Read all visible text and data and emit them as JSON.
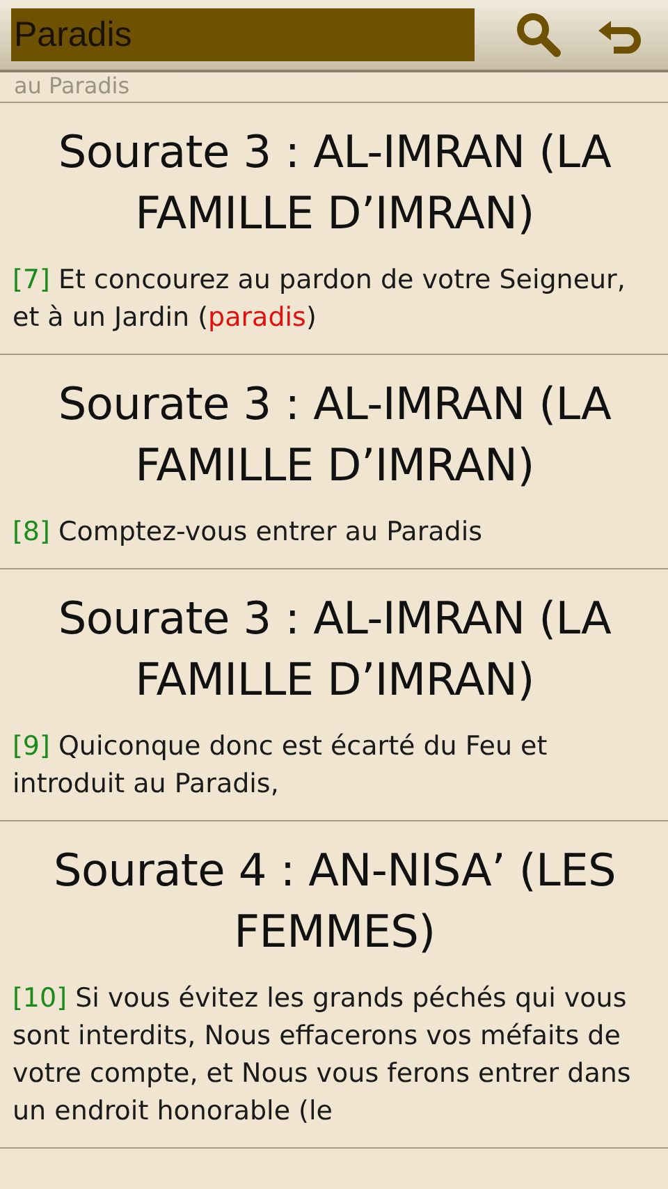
{
  "search": {
    "value": "Paradis"
  },
  "clipped_text": "au Paradis",
  "results": [
    {
      "title": "Sourate 3 : AL-IMRAN (LA FAMILLE D’IMRAN)",
      "verse_number": "[7]",
      "segments": [
        {
          "text": "Et concourez au pardon de votre Seigneur, et à un Jardin (",
          "highlight": false
        },
        {
          "text": "paradis",
          "highlight": true
        },
        {
          "text": ")",
          "highlight": false
        }
      ]
    },
    {
      "title": "Sourate 3 : AL-IMRAN (LA FAMILLE D’IMRAN)",
      "verse_number": "[8]",
      "segments": [
        {
          "text": "Comptez-vous entrer au Paradis",
          "highlight": false
        }
      ]
    },
    {
      "title": "Sourate 3 : AL-IMRAN (LA FAMILLE D’IMRAN)",
      "verse_number": "[9]",
      "segments": [
        {
          "text": "Quiconque donc est écarté du Feu et introduit au Paradis,",
          "highlight": false
        }
      ]
    },
    {
      "title": "Sourate 4 : AN-NISA’ (LES FEMMES)",
      "verse_number": "[10]",
      "segments": [
        {
          "text": "Si vous évitez les grands péchés qui vous sont interdits, Nous effacerons vos méfaits de votre compte, et Nous vous ferons entrer dans un endroit honorable (le",
          "highlight": false
        }
      ]
    }
  ]
}
